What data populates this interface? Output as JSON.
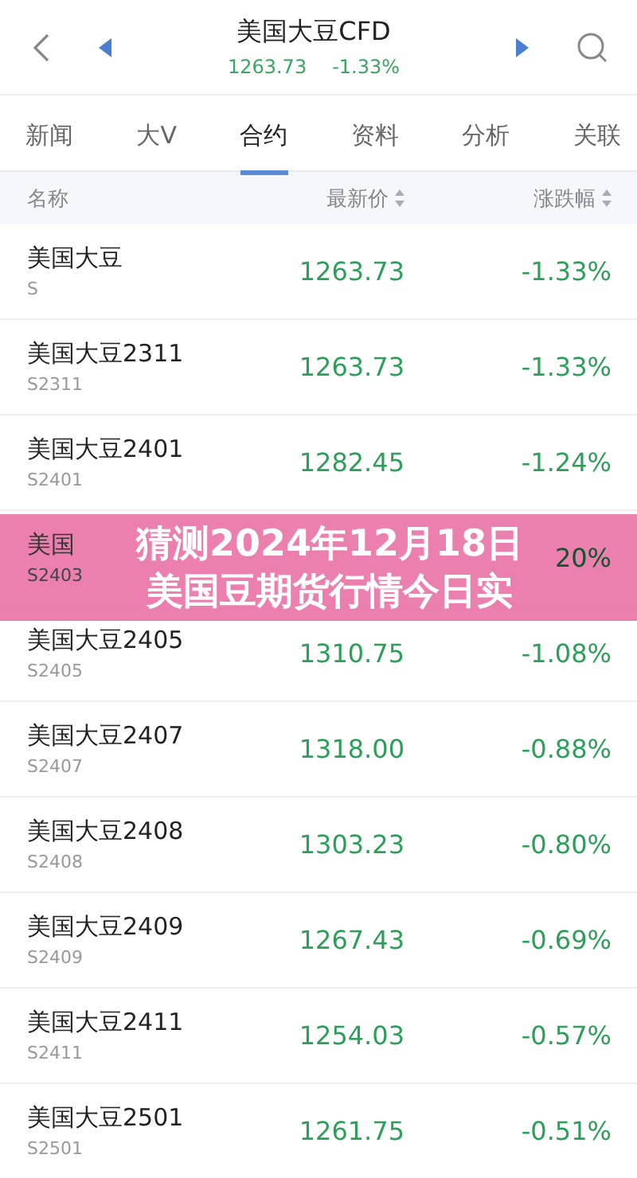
{
  "header": {
    "title": "美国大豆CFD",
    "price": "1263.73",
    "change": "-1.33%"
  },
  "tabs": [
    {
      "label": "新闻",
      "selected": false
    },
    {
      "label": "大V",
      "selected": false
    },
    {
      "label": "合约",
      "selected": true
    },
    {
      "label": "资料",
      "selected": false
    },
    {
      "label": "分析",
      "selected": false
    },
    {
      "label": "关联",
      "selected": false
    }
  ],
  "table": {
    "columns": [
      "名称",
      "最新价",
      "涨跌幅"
    ],
    "rows": [
      {
        "name": "美国大豆",
        "code": "S",
        "price": "1263.73",
        "change": "-1.33%"
      },
      {
        "name": "美国大豆2311",
        "code": "S2311",
        "price": "1263.73",
        "change": "-1.33%"
      },
      {
        "name": "美国大豆2401",
        "code": "S2401",
        "price": "1282.45",
        "change": "-1.24%"
      },
      {
        "name": "美国",
        "code": "S2403",
        "change": "20%"
      },
      {
        "name": "美国大豆2405",
        "code": "S2405",
        "price": "1310.75",
        "change": "-1.08%"
      },
      {
        "name": "美国大豆2407",
        "code": "S2407",
        "price": "1318.00",
        "change": "-0.88%"
      },
      {
        "name": "美国大豆2408",
        "code": "S2408",
        "price": "1303.23",
        "change": "-0.80%"
      },
      {
        "name": "美国大豆2409",
        "code": "S2409",
        "price": "1267.43",
        "change": "-0.69%"
      },
      {
        "name": "美国大豆2411",
        "code": "S2411",
        "price": "1254.03",
        "change": "-0.57%"
      },
      {
        "name": "美国大豆2501",
        "code": "S2501",
        "price": "1261.75",
        "change": "-0.51%"
      }
    ]
  },
  "banner": {
    "lines": [
      "猜测2024年12月18日",
      "美国豆期货行情今日实"
    ]
  }
}
